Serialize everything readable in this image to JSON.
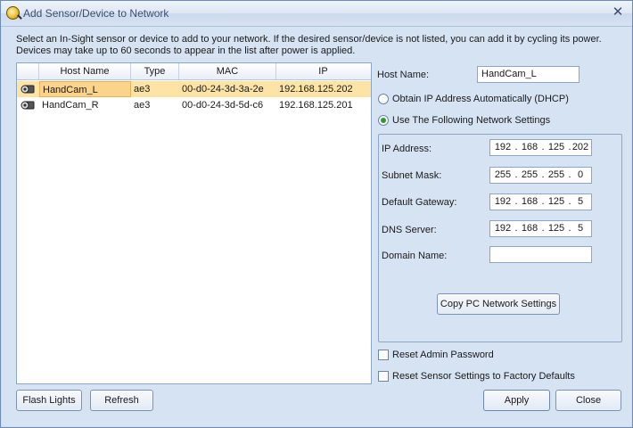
{
  "window": {
    "title": "Add Sensor/Device to Network"
  },
  "intro_text": "Select an In-Sight sensor or device to add to your network.  If the desired sensor/device is not listed, you can add it by cycling its power.  Devices may take up to 60 seconds to appear in the list after power is applied.",
  "table": {
    "columns": [
      "Host Name",
      "Type",
      "MAC",
      "IP"
    ],
    "rows": [
      {
        "host": "HandCam_L",
        "type": "ae3",
        "mac": "00-d0-24-3d-3a-2e",
        "ip": "192.168.125.202",
        "selected": true
      },
      {
        "host": "HandCam_R",
        "type": "ae3",
        "mac": "00-d0-24-3d-5d-c6",
        "ip": "192.168.125.201",
        "selected": false
      }
    ]
  },
  "host_name": {
    "label": "Host Name:",
    "value": "HandCam_L"
  },
  "network": {
    "dhcp_label": "Obtain IP Address Automatically (DHCP)",
    "static_label": "Use The Following Network Settings",
    "mode": "static",
    "ip_address": {
      "label": "IP Address:",
      "octets": [
        "192",
        "168",
        "125",
        "202"
      ]
    },
    "subnet_mask": {
      "label": "Subnet Mask:",
      "octets": [
        "255",
        "255",
        "255",
        "0"
      ]
    },
    "default_gateway": {
      "label": "Default Gateway:",
      "octets": [
        "192",
        "168",
        "125",
        "5"
      ]
    },
    "dns_server": {
      "label": "DNS Server:",
      "octets": [
        "192",
        "168",
        "125",
        "5"
      ]
    },
    "domain_name": {
      "label": "Domain Name:",
      "value": ""
    },
    "copy_button": "Copy PC Network Settings"
  },
  "options": {
    "reset_password": {
      "label": "Reset Admin Password",
      "checked": false
    },
    "reset_factory": {
      "label": "Reset Sensor Settings to Factory Defaults",
      "checked": false
    }
  },
  "buttons": {
    "flash": "Flash Lights",
    "refresh": "Refresh",
    "apply": "Apply",
    "close": "Close"
  }
}
